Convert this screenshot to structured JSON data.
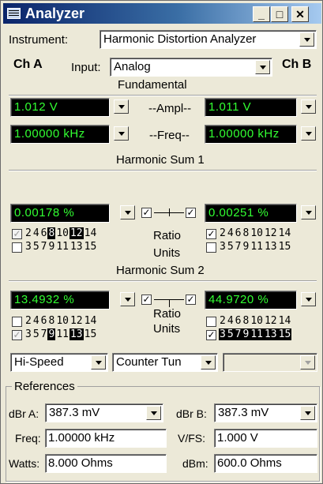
{
  "window": {
    "title": "Analyzer",
    "icon": "window-list-icon"
  },
  "title_buttons": {
    "minimize": "_",
    "maximize": "□",
    "close": "✕"
  },
  "instrument": {
    "label": "Instrument:",
    "value": "Harmonic Distortion Analyzer"
  },
  "input": {
    "chA": "Ch A",
    "label": "Input:",
    "value": "Analog",
    "chB": "Ch B"
  },
  "fundamental": {
    "heading": "Fundamental",
    "ampl_label": "--Ampl--",
    "freq_label": "--Freq--",
    "ampl_a": "1.012   V",
    "ampl_b": "1.011   V",
    "freq_a": "1.00000 kHz",
    "freq_b": "1.00000 kHz"
  },
  "hs1": {
    "heading": "Harmonic Sum 1",
    "value_a": "0.00178  %",
    "value_b": "0.00251  %",
    "ratio": "Ratio",
    "units": "Units",
    "even": [
      "2",
      "4",
      "6",
      "8",
      "10",
      "12",
      "14"
    ],
    "odd": [
      "3",
      "5",
      "7",
      "9",
      "11",
      "13",
      "15"
    ],
    "a_even_on": [
      false,
      false,
      false,
      true,
      false,
      true,
      false
    ],
    "a_odd_on": [
      false,
      false,
      false,
      false,
      false,
      false,
      false
    ],
    "b_even_on": [
      false,
      false,
      false,
      false,
      false,
      false,
      false
    ],
    "b_odd_on": [
      false,
      false,
      false,
      false,
      false,
      false,
      false
    ],
    "a_even_check": "✓",
    "a_odd_check": "",
    "b_even_check": "✓",
    "b_odd_check": ""
  },
  "hs2": {
    "heading": "Harmonic Sum 2",
    "value_a": "13.4932  %",
    "value_b": "44.9720  %",
    "ratio": "Ratio",
    "units": "Units",
    "even": [
      "2",
      "4",
      "6",
      "8",
      "10",
      "12",
      "14"
    ],
    "odd": [
      "3",
      "5",
      "7",
      "9",
      "11",
      "13",
      "15"
    ],
    "a_even_on": [
      false,
      false,
      false,
      false,
      false,
      false,
      false
    ],
    "a_odd_on": [
      false,
      false,
      false,
      true,
      false,
      true,
      false
    ],
    "b_even_on": [
      false,
      false,
      false,
      false,
      false,
      false,
      false
    ],
    "b_odd_on": [
      true,
      true,
      true,
      true,
      true,
      true,
      true
    ],
    "a_even_check": "",
    "a_odd_check": "✓",
    "b_even_check": "",
    "b_odd_check": "✓"
  },
  "mode": {
    "speed": "Hi-Speed",
    "tuning": "Counter Tun",
    "third": ""
  },
  "references": {
    "heading": "References",
    "dbra_label": "dBr A:",
    "dbra_value": "387.3   mV",
    "dbrb_label": "dBr B:",
    "dbrb_value": "387.3   mV",
    "freq_label": "Freq:",
    "freq_value": "1.00000 kHz",
    "vfs_label": "V/FS:",
    "vfs_value": "1.000    V",
    "watts_label": "Watts:",
    "watts_value": "8.000   Ohms",
    "dbm_label": "dBm:",
    "dbm_value": "600.0   Ohms"
  }
}
